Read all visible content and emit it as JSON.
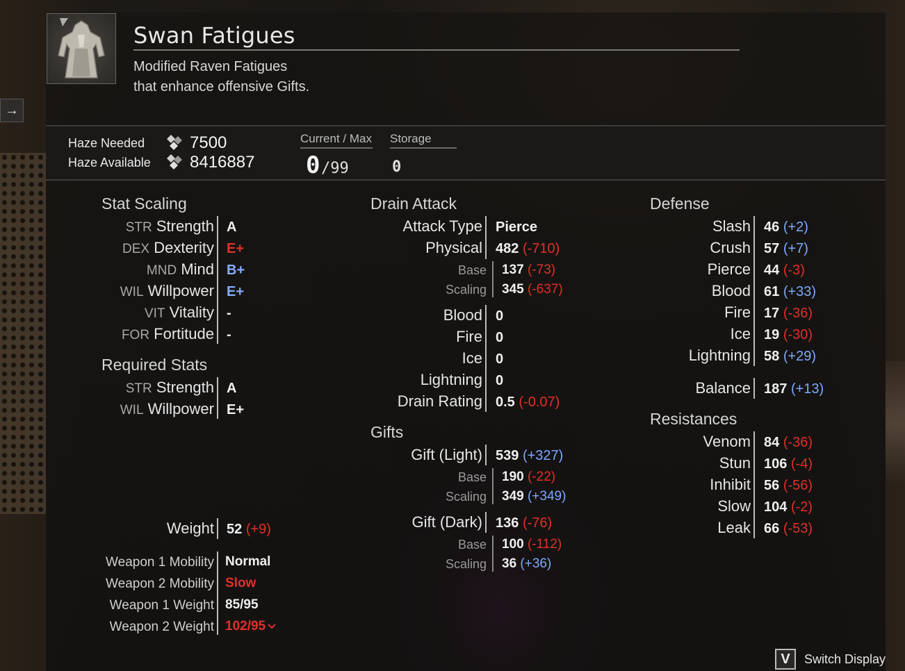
{
  "item": {
    "name": "Swan Fatigues",
    "description_line1": "Modified Raven Fatigues",
    "description_line2": "that enhance offensive Gifts."
  },
  "haze": {
    "needed_label": "Haze Needed",
    "needed_value": "7500",
    "available_label": "Haze Available",
    "available_value": "8416887",
    "current_max_label": "Current / Max",
    "current_value": "0",
    "max_value": "/99",
    "storage_label": "Storage",
    "storage_value": "0",
    "icon": "haze-crystal-icon"
  },
  "stat_scaling": {
    "title": "Stat Scaling",
    "rows": [
      {
        "abbr": "STR",
        "name": "Strength",
        "grade": "A",
        "color": "#f0f0f0"
      },
      {
        "abbr": "DEX",
        "name": "Dexterity",
        "grade": "E+",
        "color": "#e0302a"
      },
      {
        "abbr": "MND",
        "name": "Mind",
        "grade": "B+",
        "color": "#86acff"
      },
      {
        "abbr": "WIL",
        "name": "Willpower",
        "grade": "E+",
        "color": "#86acff"
      },
      {
        "abbr": "VIT",
        "name": "Vitality",
        "grade": "-",
        "color": "#f0f0f0"
      },
      {
        "abbr": "FOR",
        "name": "Fortitude",
        "grade": "-",
        "color": "#f0f0f0"
      }
    ]
  },
  "required_stats": {
    "title": "Required Stats",
    "rows": [
      {
        "abbr": "STR",
        "name": "Strength",
        "grade": "A"
      },
      {
        "abbr": "WIL",
        "name": "Willpower",
        "grade": "E+"
      }
    ]
  },
  "weight": {
    "label": "Weight",
    "value": "52",
    "delta": "(+9)"
  },
  "mobility": [
    {
      "label": "Weapon 1 Mobility",
      "value": "Normal",
      "state": "normal"
    },
    {
      "label": "Weapon 2 Mobility",
      "value": "Slow",
      "state": "bad"
    },
    {
      "label": "Weapon 1 Weight",
      "value": "85/95",
      "state": "normal"
    },
    {
      "label": "Weapon 2 Weight",
      "value": "102/95",
      "state": "bad",
      "indicator": "chevron-down-icon"
    }
  ],
  "drain_attack": {
    "title": "Drain Attack",
    "attack_type_label": "Attack Type",
    "attack_type_value": "Pierce",
    "physical": {
      "label": "Physical",
      "value": "482",
      "delta": "(-710)"
    },
    "physical_base": {
      "label": "Base",
      "value": "137",
      "delta": "(-73)"
    },
    "physical_scaling": {
      "label": "Scaling",
      "value": "345",
      "delta": "(-637)"
    },
    "elements": [
      {
        "label": "Blood",
        "value": "0"
      },
      {
        "label": "Fire",
        "value": "0"
      },
      {
        "label": "Ice",
        "value": "0"
      },
      {
        "label": "Lightning",
        "value": "0"
      }
    ],
    "drain_rating": {
      "label": "Drain Rating",
      "value": "0.5",
      "delta": "(-0.07)"
    }
  },
  "gifts": {
    "title": "Gifts",
    "light": {
      "label": "Gift (Light)",
      "value": "539",
      "delta": "(+327)"
    },
    "light_base": {
      "label": "Base",
      "value": "190",
      "delta": "(-22)"
    },
    "light_scaling": {
      "label": "Scaling",
      "value": "349",
      "delta": "(+349)"
    },
    "dark": {
      "label": "Gift (Dark)",
      "value": "136",
      "delta": "(-76)"
    },
    "dark_base": {
      "label": "Base",
      "value": "100",
      "delta": "(-112)"
    },
    "dark_scaling": {
      "label": "Scaling",
      "value": "36",
      "delta": "(+36)"
    }
  },
  "defense": {
    "title": "Defense",
    "rows": [
      {
        "label": "Slash",
        "value": "46",
        "delta": "(+2)",
        "sign": "pos"
      },
      {
        "label": "Crush",
        "value": "57",
        "delta": "(+7)",
        "sign": "pos"
      },
      {
        "label": "Pierce",
        "value": "44",
        "delta": "(-3)",
        "sign": "neg"
      },
      {
        "label": "Blood",
        "value": "61",
        "delta": "(+33)",
        "sign": "pos"
      },
      {
        "label": "Fire",
        "value": "17",
        "delta": "(-36)",
        "sign": "neg"
      },
      {
        "label": "Ice",
        "value": "19",
        "delta": "(-30)",
        "sign": "neg"
      },
      {
        "label": "Lightning",
        "value": "58",
        "delta": "(+29)",
        "sign": "pos"
      }
    ],
    "balance": {
      "label": "Balance",
      "value": "187",
      "delta": "(+13)",
      "sign": "pos"
    }
  },
  "resistances": {
    "title": "Resistances",
    "rows": [
      {
        "label": "Venom",
        "value": "84",
        "delta": "(-36)",
        "sign": "neg"
      },
      {
        "label": "Stun",
        "value": "106",
        "delta": "(-4)",
        "sign": "neg"
      },
      {
        "label": "Inhibit",
        "value": "56",
        "delta": "(-56)",
        "sign": "neg"
      },
      {
        "label": "Slow",
        "value": "104",
        "delta": "(-2)",
        "sign": "neg"
      },
      {
        "label": "Leak",
        "value": "66",
        "delta": "(-53)",
        "sign": "neg"
      }
    ]
  },
  "footer": {
    "key": "V",
    "switch_label": "Switch Display"
  },
  "side_arrow": "→"
}
